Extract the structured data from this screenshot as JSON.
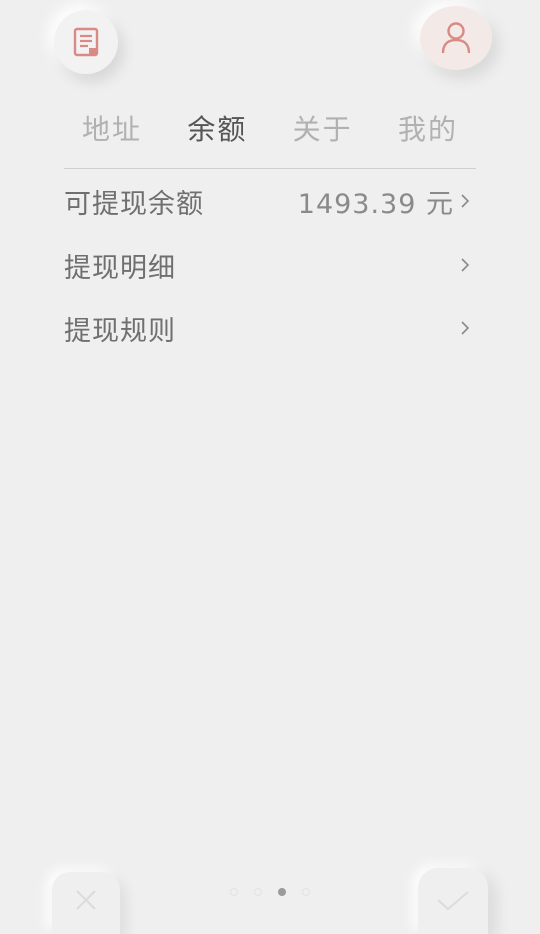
{
  "tabs": [
    {
      "label": "地址",
      "active": false
    },
    {
      "label": "余额",
      "active": true
    },
    {
      "label": "关于",
      "active": false
    },
    {
      "label": "我的",
      "active": false
    }
  ],
  "balance": {
    "withdrawable_label": "可提现余额",
    "withdrawable_value": "1493.39 元",
    "detail_label": "提现明细",
    "rules_label": "提现规则"
  },
  "pagination": {
    "current": 3,
    "total": 4
  },
  "colors": {
    "background": "#efefef",
    "accent": "#d98a84",
    "tab_active": "#555555",
    "tab_inactive": "#b1b1b1"
  },
  "icons": {
    "top_left": "document-icon",
    "top_right": "user-icon",
    "bottom_left": "close-icon",
    "bottom_right": "check-icon",
    "row_arrow": "chevron-right-icon"
  }
}
